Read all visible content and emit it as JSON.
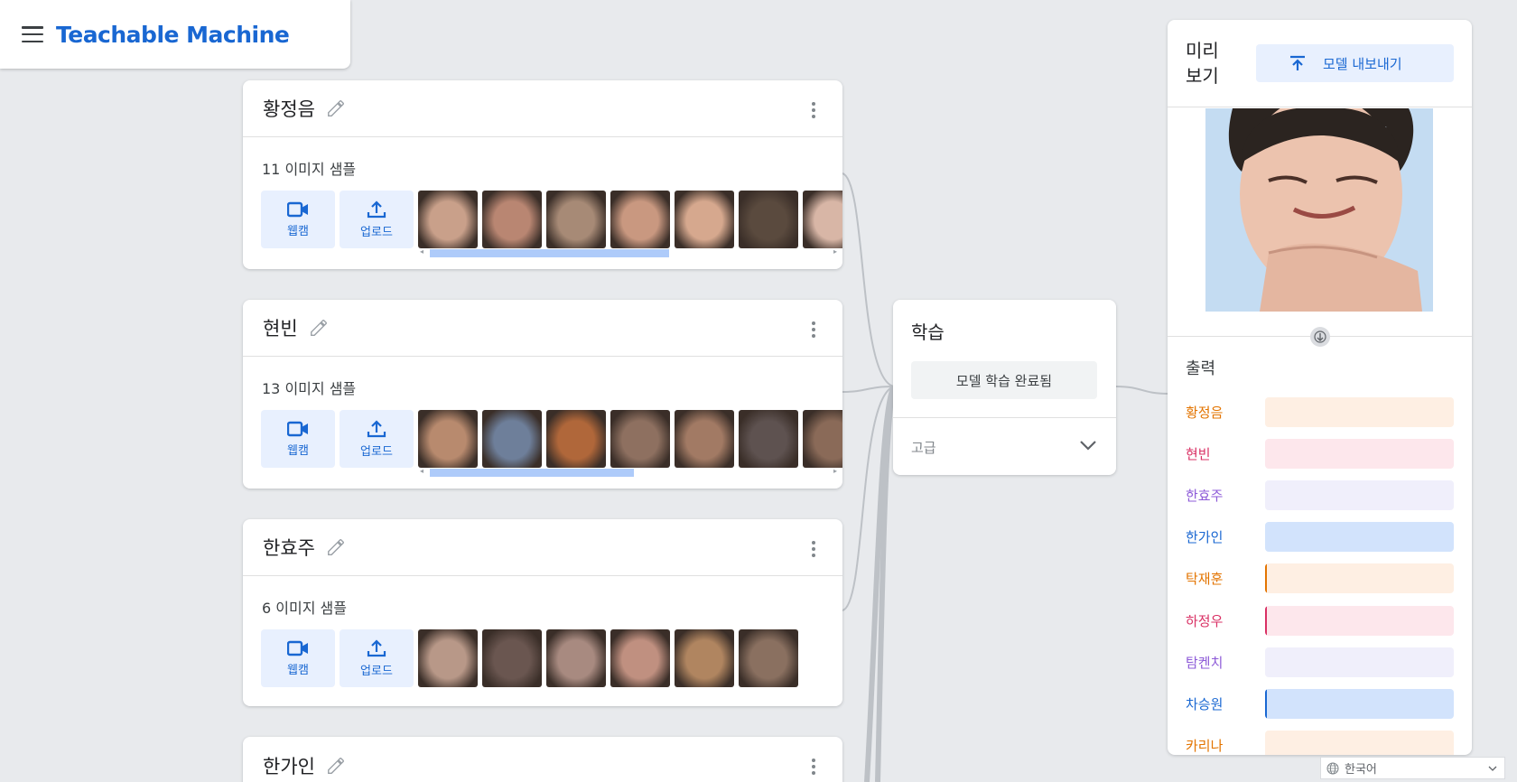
{
  "header": {
    "brand": "Teachable Machine"
  },
  "classes": [
    {
      "name": "황정음",
      "count": "11",
      "samples_label": "이미지 샘플",
      "webcam": "웹캠",
      "upload": "업로드",
      "thumb_colors": [
        "#c9a08a",
        "#b98672",
        "#a78a76",
        "#c99880",
        "#d6a88e",
        "#5a4a3e",
        "#d8b6a6"
      ]
    },
    {
      "name": "현빈",
      "count": "13",
      "samples_label": "이미지 샘플",
      "webcam": "웹캠",
      "upload": "업로드",
      "thumb_colors": [
        "#b88a6e",
        "#6e7f9a",
        "#b0673a",
        "#8e7060",
        "#a27a64",
        "#5e5250",
        "#8a6a58"
      ]
    },
    {
      "name": "한효주",
      "count": "6",
      "samples_label": "이미지 샘플",
      "webcam": "웹캠",
      "upload": "업로드",
      "thumb_colors": [
        "#b89888",
        "#6a5650",
        "#a88a80",
        "#c09080",
        "#b08560",
        "#8a7060"
      ]
    },
    {
      "name": "한가인"
    }
  ],
  "train": {
    "title": "학습",
    "button": "모델 학습 완료됨",
    "advanced": "고급"
  },
  "preview": {
    "title": "미리 보기",
    "export_button": "모델 내보내기",
    "output_title": "출력",
    "outputs": [
      {
        "label": "황정음",
        "color": "#e37400",
        "bg": "#feefe3",
        "fill": 0.0
      },
      {
        "label": "현빈",
        "color": "#d93064",
        "bg": "#fde7ec",
        "fill": 0.0
      },
      {
        "label": "한효주",
        "color": "#8e5bd8",
        "bg": "#f0effb",
        "fill": 0.0
      },
      {
        "label": "한가인",
        "color": "#1967d2",
        "bg": "#d2e3fc",
        "fill": 0.0
      },
      {
        "label": "탁재훈",
        "color": "#e37400",
        "bg": "#feefe3",
        "fill": 0.01
      },
      {
        "label": "하정우",
        "color": "#d93064",
        "bg": "#fde7ec",
        "fill": 0.01
      },
      {
        "label": "탐켄치",
        "color": "#8e5bd8",
        "bg": "#f0effb",
        "fill": 0.0
      },
      {
        "label": "차승원",
        "color": "#1967d2",
        "bg": "#d2e3fc",
        "fill": 0.01
      },
      {
        "label": "카리나",
        "color": "#e37400",
        "bg": "#feefe3",
        "fill": 0.0
      }
    ]
  },
  "language": {
    "selected": "한국어"
  }
}
